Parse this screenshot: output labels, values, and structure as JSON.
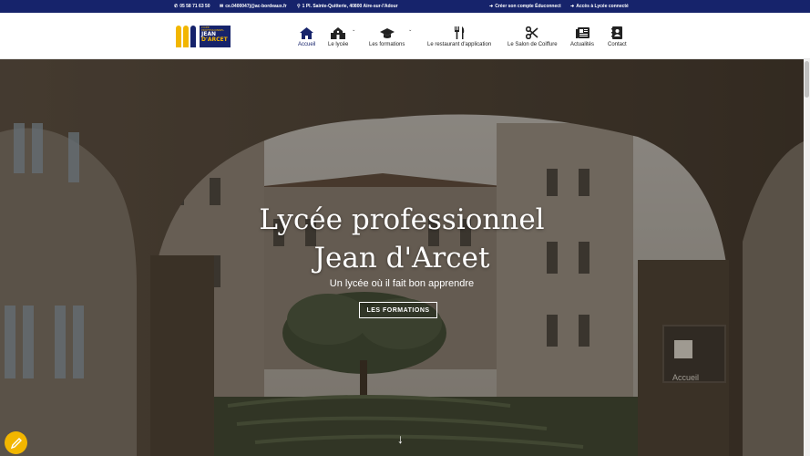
{
  "topbar": {
    "phone": "05 58 71 63 50",
    "email": "ce.0400047j@ac-bordeaux.fr",
    "address": "1 Pl. Sainte-Quitterie, 40800 Aire-sur-l'Adour",
    "educonnect": "Créer son compte Éduconnect",
    "lycee_connecte": "Accès à Lycée connecté"
  },
  "logo": {
    "line1": "LYCÉE PROFESSIONNEL",
    "line2": "JEAN",
    "line3": "D'ARCET"
  },
  "nav": [
    {
      "label": "Accueil",
      "icon": "home-icon",
      "active": true
    },
    {
      "label": "Le lycée",
      "icon": "school-icon",
      "has_caret": true
    },
    {
      "label": "Les formations",
      "icon": "graduation-cap-icon",
      "has_caret": true
    },
    {
      "label": "Le restaurant d'application",
      "icon": "utensils-icon"
    },
    {
      "label": "Le Salon de Coiffure",
      "icon": "scissors-icon"
    },
    {
      "label": "Actualités",
      "icon": "newspaper-icon"
    },
    {
      "label": "Contact",
      "icon": "address-book-icon"
    }
  ],
  "hero": {
    "title_line1": "Lycée professionnel",
    "title_line2": "Jean d'Arcet",
    "subtitle": "Un lycée où il fait bon apprendre",
    "button": "LES FORMATIONS",
    "sign_text": "Accueil"
  },
  "colors": {
    "navy": "#16236b",
    "yellow": "#f2b600"
  }
}
